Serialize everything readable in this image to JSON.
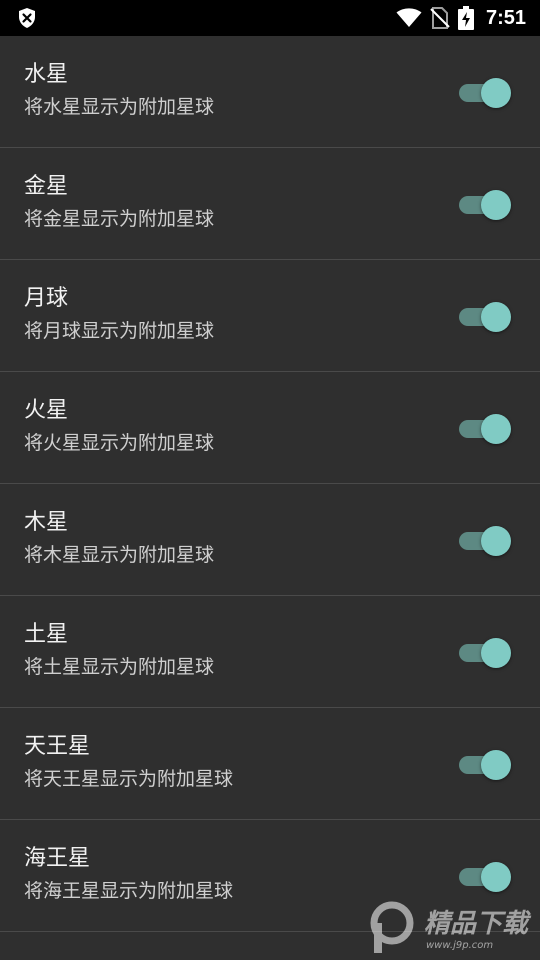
{
  "status_bar": {
    "time": "7:51",
    "icons": [
      "shield-x-icon",
      "wifi-icon",
      "no-sim-icon",
      "battery-charging-icon"
    ]
  },
  "settings": {
    "items": [
      {
        "title": "水星",
        "subtitle": "将水星显示为附加星球",
        "enabled": true
      },
      {
        "title": "金星",
        "subtitle": "将金星显示为附加星球",
        "enabled": true
      },
      {
        "title": "月球",
        "subtitle": "将月球显示为附加星球",
        "enabled": true
      },
      {
        "title": "火星",
        "subtitle": "将火星显示为附加星球",
        "enabled": true
      },
      {
        "title": "木星",
        "subtitle": "将木星显示为附加星球",
        "enabled": true
      },
      {
        "title": "土星",
        "subtitle": "将土星显示为附加星球",
        "enabled": true
      },
      {
        "title": "天王星",
        "subtitle": "将天王星显示为附加星球",
        "enabled": true
      },
      {
        "title": "海王星",
        "subtitle": "将海王星显示为附加星球",
        "enabled": true
      }
    ]
  },
  "watermark": {
    "text": "精品下载",
    "url": "www.j9p.com"
  },
  "colors": {
    "background": "#2f2f2f",
    "switch_thumb": "#80cbc4",
    "switch_track": "#5d8983"
  }
}
